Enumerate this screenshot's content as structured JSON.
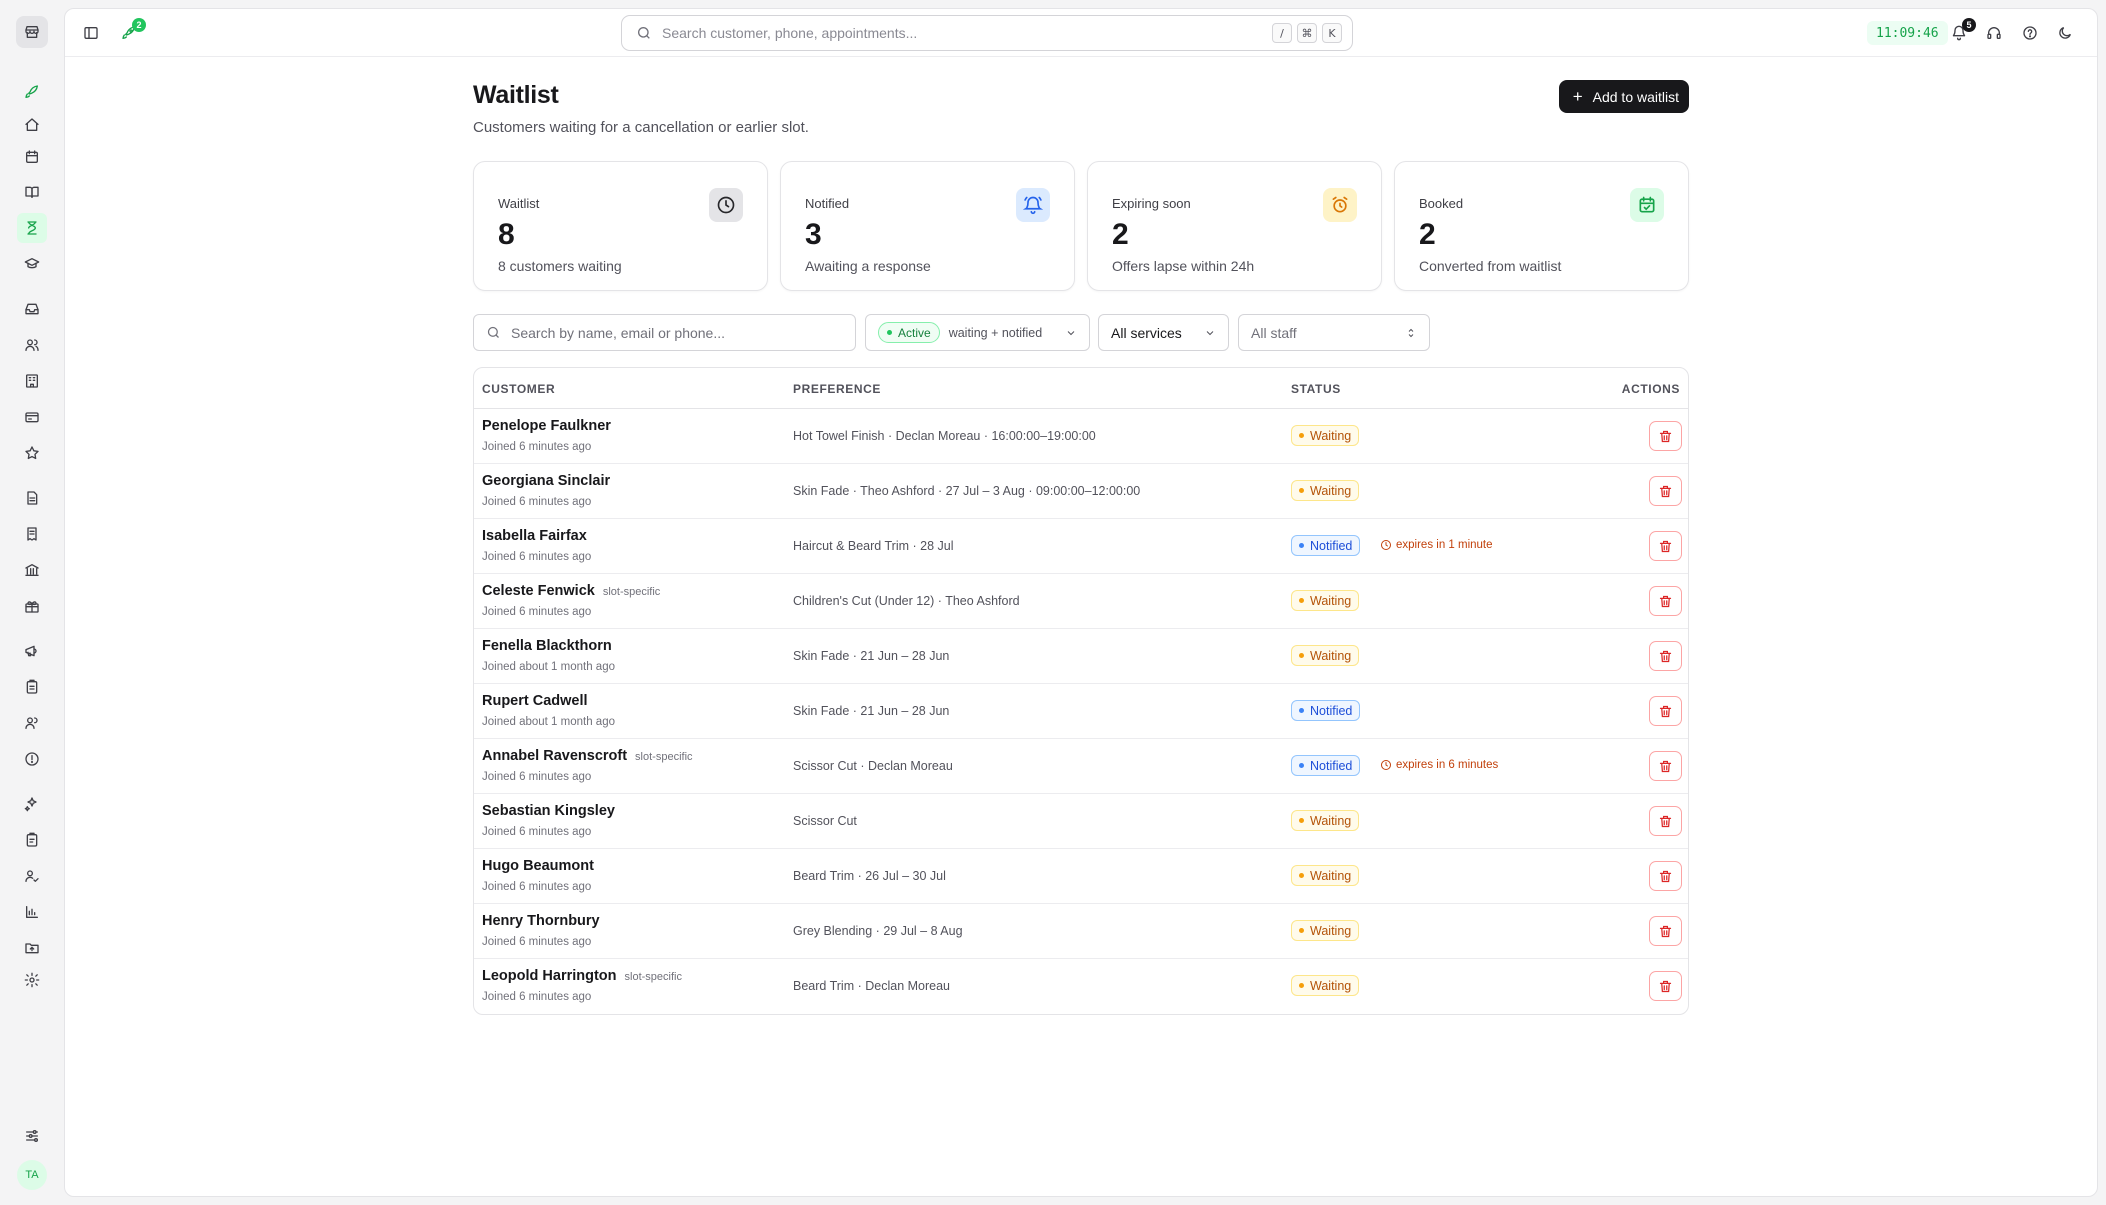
{
  "search": {
    "placeholder": "Search customer, phone, appointments...",
    "shortcuts": [
      "/",
      "⌘",
      "K"
    ]
  },
  "topbar": {
    "time": "11:09:46",
    "notifications_count": "5",
    "rocket_count": "2"
  },
  "sidebar": {
    "avatar_initials": "TA"
  },
  "page": {
    "title": "Waitlist",
    "subtitle": "Customers waiting for a cancellation or earlier slot.",
    "add_button": "Add to waitlist"
  },
  "stats": [
    {
      "label": "Waitlist",
      "value": "8",
      "desc": "8 customers waiting",
      "icon": "clock-icon"
    },
    {
      "label": "Notified",
      "value": "3",
      "desc": "Awaiting a response",
      "icon": "bell-ring-icon"
    },
    {
      "label": "Expiring soon",
      "value": "2",
      "desc": "Offers lapse within 24h",
      "icon": "alarm-clock-icon"
    },
    {
      "label": "Booked",
      "value": "2",
      "desc": "Converted from waitlist",
      "icon": "calendar-check-icon"
    }
  ],
  "filters": {
    "search_placeholder": "Search by name, email or phone...",
    "status_pill": "Active",
    "status_sub": "waiting + notified",
    "services": "All services",
    "staff": "All staff"
  },
  "table": {
    "headers": {
      "customer": "CUSTOMER",
      "preference": "PREFERENCE",
      "status": "STATUS",
      "actions": "ACTIONS"
    },
    "rows": [
      {
        "name": "Penelope Faulkner",
        "tag": "",
        "joined": "Joined 6 minutes ago",
        "preference": "Hot Towel Finish · Declan Moreau · 16:00:00–19:00:00",
        "status": "Waiting",
        "expires": ""
      },
      {
        "name": "Georgiana Sinclair",
        "tag": "",
        "joined": "Joined 6 minutes ago",
        "preference": "Skin Fade · Theo Ashford · 27 Jul – 3 Aug · 09:00:00–12:00:00",
        "status": "Waiting",
        "expires": ""
      },
      {
        "name": "Isabella Fairfax",
        "tag": "",
        "joined": "Joined 6 minutes ago",
        "preference": "Haircut & Beard Trim · 28 Jul",
        "status": "Notified",
        "expires": "expires in 1 minute"
      },
      {
        "name": "Celeste Fenwick",
        "tag": "slot-specific",
        "joined": "Joined 6 minutes ago",
        "preference": "Children's Cut (Under 12) · Theo Ashford",
        "status": "Waiting",
        "expires": ""
      },
      {
        "name": "Fenella Blackthorn",
        "tag": "",
        "joined": "Joined about 1 month ago",
        "preference": "Skin Fade · 21 Jun – 28 Jun",
        "status": "Waiting",
        "expires": ""
      },
      {
        "name": "Rupert Cadwell",
        "tag": "",
        "joined": "Joined about 1 month ago",
        "preference": "Skin Fade · 21 Jun – 28 Jun",
        "status": "Notified",
        "expires": ""
      },
      {
        "name": "Annabel Ravenscroft",
        "tag": "slot-specific",
        "joined": "Joined 6 minutes ago",
        "preference": "Scissor Cut · Declan Moreau",
        "status": "Notified",
        "expires": "expires in 6 minutes"
      },
      {
        "name": "Sebastian Kingsley",
        "tag": "",
        "joined": "Joined 6 minutes ago",
        "preference": "Scissor Cut",
        "status": "Waiting",
        "expires": ""
      },
      {
        "name": "Hugo Beaumont",
        "tag": "",
        "joined": "Joined 6 minutes ago",
        "preference": "Beard Trim · 26 Jul – 30 Jul",
        "status": "Waiting",
        "expires": ""
      },
      {
        "name": "Henry Thornbury",
        "tag": "",
        "joined": "Joined 6 minutes ago",
        "preference": "Grey Blending · 29 Jul – 8 Aug",
        "status": "Waiting",
        "expires": ""
      },
      {
        "name": "Leopold Harrington",
        "tag": "slot-specific",
        "joined": "Joined 6 minutes ago",
        "preference": "Beard Trim · Declan Moreau",
        "status": "Waiting",
        "expires": ""
      }
    ]
  },
  "colors": {
    "accent": "#16a34a",
    "primary_button": "#18181b",
    "waiting": "#b45309",
    "notified": "#1d4ed8",
    "danger": "#dc2626"
  }
}
